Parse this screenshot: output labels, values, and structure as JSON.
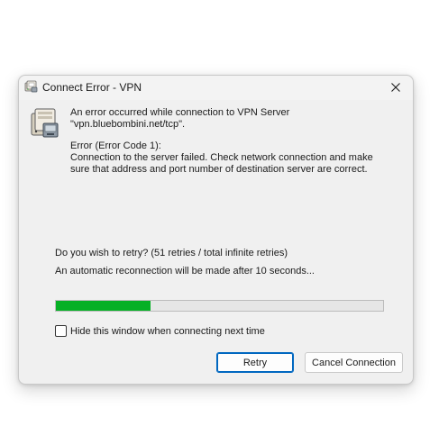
{
  "window": {
    "title": "Connect Error - VPN"
  },
  "message": {
    "line1": "An error occurred while connection to VPN Server \"vpn.bluebombini.net/tcp\".",
    "error_code": "Error (Error Code 1):",
    "error_detail": "Connection to the server failed. Check network connection and make sure that address and port number of destination server are correct."
  },
  "retry": {
    "question": "Do you wish to retry? (51 retries / total infinite retries)",
    "auto_reconnect": "An automatic reconnection will be made after 10 seconds...",
    "progress_fraction": 0.29
  },
  "options": {
    "hide_window_label": "Hide this window when connecting next time",
    "hide_window_checked": false
  },
  "buttons": {
    "retry_label": "Retry",
    "cancel_label": "Cancel Connection"
  },
  "icons": {
    "title": "vpn-computer-icon",
    "message": "vpn-server-icon",
    "close": "close-icon"
  },
  "colors": {
    "progress_fill": "#06b025",
    "default_button_border": "#0067c0"
  }
}
